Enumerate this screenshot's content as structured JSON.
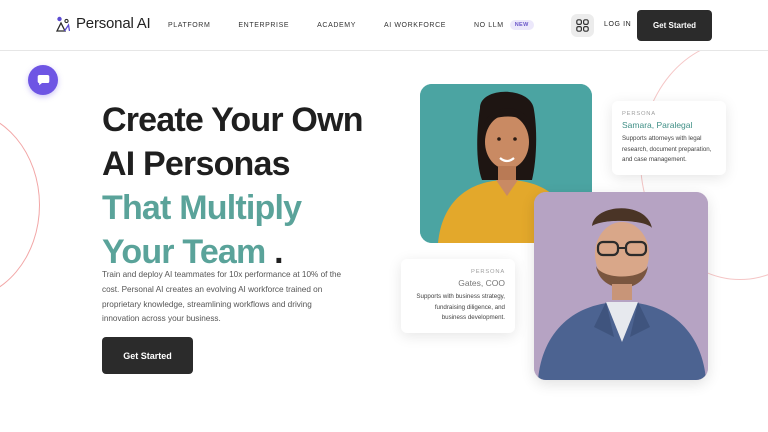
{
  "brand": {
    "name": "Personal",
    "suffix": " AI",
    "mark_color": "#5b4bd1"
  },
  "nav": {
    "items": [
      {
        "label": "PLATFORM"
      },
      {
        "label": "ENTERPRISE"
      },
      {
        "label": "ACADEMY"
      },
      {
        "label": "AI WORKFORCE"
      },
      {
        "label": "NO LLM",
        "badge": "NEW"
      }
    ],
    "login_label": "LOG IN",
    "cta_label": "Get Started",
    "grid_icon": "grid-icon"
  },
  "chat": {
    "icon": "chat-icon",
    "color": "#6e55e4"
  },
  "hero": {
    "title_line1": "Create Your Own",
    "title_line2": "AI Personas",
    "title_line3": "That Multiply",
    "title_line4": "Your Team",
    "title_dot": ".",
    "description": "Train and deploy AI teammates for 10x performance at 10% of the cost. Personal AI creates an evolving AI workforce trained on proprietary knowledge, streamlining workflows and driving innovation across your business.",
    "cta_label": "Get Started",
    "accent_color": "#5aa39a"
  },
  "personas": [
    {
      "kicker": "PERSONA",
      "name": "Samara, Paralegal",
      "description": "Supports attorneys with legal research, document preparation, and case management."
    },
    {
      "kicker": "PERSONA",
      "name": "Gates, COO",
      "description": "Supports with business strategy, fundraising diligence, and business development."
    }
  ]
}
